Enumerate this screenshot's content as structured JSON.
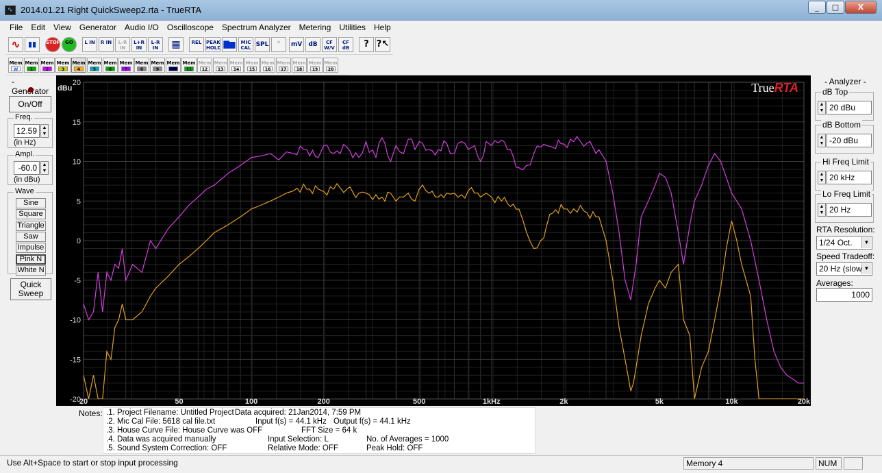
{
  "window": {
    "title": "2014.01.21 Right QuickSweep2.rta - TrueRTA",
    "min": "_",
    "max": "□",
    "close": "X"
  },
  "menu": [
    "File",
    "Edit",
    "View",
    "Generator",
    "Audio I/O",
    "Oscilloscope",
    "Spectrum Analyzer",
    "Metering",
    "Utilities",
    "Help"
  ],
  "toolbar1": [
    {
      "name": "sine-wave-icon",
      "t": "∿",
      "x": 4
    },
    {
      "name": "spectrum-icon",
      "t": "▮▮",
      "x": 28
    },
    {
      "name": "stop-button",
      "t": "STOP",
      "x": 58
    },
    {
      "name": "go-button",
      "t": "GO",
      "x": 82
    },
    {
      "name": "l-in-button",
      "t": "L IN",
      "x": 112
    },
    {
      "name": "r-in-button",
      "t": "R IN",
      "x": 136
    },
    {
      "name": "l-r-in-button",
      "t": "L-R IN",
      "x": 160,
      "dis": true
    },
    {
      "name": "lr-in-button",
      "t": "L+R IN",
      "x": 184
    },
    {
      "name": "lmr-in-button",
      "t": "L-R IN",
      "x": 208
    },
    {
      "name": "grid-button",
      "t": "▦",
      "x": 238
    },
    {
      "name": "rel-button",
      "t": "REL",
      "x": 268
    },
    {
      "name": "peak-hold-button",
      "t": "PEAK HOLD",
      "x": 292
    },
    {
      "name": "bars-button",
      "t": "▇▆",
      "x": 316
    },
    {
      "name": "mic-cal-button",
      "t": "MIC CAL",
      "x": 340
    },
    {
      "name": "spl-button",
      "t": "SPL",
      "x": 364
    },
    {
      "name": "x-button",
      "t": "✕",
      "x": 388,
      "dis": true
    },
    {
      "name": "mv-button",
      "t": "mV",
      "x": 414
    },
    {
      "name": "db-button",
      "t": "dB",
      "x": 438
    },
    {
      "name": "cf-wv-button",
      "t": "CF W/V",
      "x": 462
    },
    {
      "name": "cf-db-button",
      "t": "CF dB",
      "x": 486
    },
    {
      "name": "help-button",
      "t": "?",
      "x": 516
    },
    {
      "name": "context-help-button",
      "t": "?↖",
      "x": 540
    }
  ],
  "memory": [
    "W",
    "1",
    "2",
    "3",
    "4",
    "5",
    "6",
    "7",
    "8",
    "9",
    "10",
    "11",
    "12",
    "13",
    "14",
    "15",
    "16",
    "17",
    "18",
    "19",
    "20"
  ],
  "memory_prefix": "Mem",
  "generator": {
    "legend": "- Generator -",
    "onoff": "On/Off",
    "freq_label": "Freq.",
    "freq_value": "12.59",
    "freq_unit": "(in Hz)",
    "ampl_label": "Ampl.",
    "ampl_value": "-60.0",
    "ampl_unit": "(in dBu)",
    "wave_label": "Wave",
    "waves": [
      "Sine",
      "Square",
      "Triangle",
      "Saw",
      "Impulse",
      "Pink N",
      "White N"
    ],
    "quick1": "Quick",
    "quick2": "Sweep"
  },
  "analyzer": {
    "legend": "- Analyzer -",
    "dbtop_label": "dB Top",
    "dbtop": "20 dBu",
    "dbbot_label": "dB Bottom",
    "dbbot": "-20 dBu",
    "hifreq_label": "Hi Freq Limit",
    "hifreq": "20 kHz",
    "lofreq_label": "Lo Freq Limit",
    "lofreq": "20 Hz",
    "res_label": "RTA Resolution:",
    "res": "1/24 Oct.",
    "speed_label": "Speed Tradeoff:",
    "speed": "20 Hz (slow)",
    "avg_label": "Averages:",
    "avg": "1000"
  },
  "chart_data": {
    "type": "line",
    "brand": "True",
    "brand2": "RTA",
    "ylabel": "dBu",
    "yticks": [
      "20",
      "15",
      "10",
      "5",
      "0",
      "-5",
      "-10",
      "-15",
      "-20"
    ],
    "xticks": [
      {
        "f": 20,
        "l": "20"
      },
      {
        "f": 50,
        "l": "50"
      },
      {
        "f": 100,
        "l": "100"
      },
      {
        "f": 200,
        "l": "200"
      },
      {
        "f": 500,
        "l": "500"
      },
      {
        "f": 1000,
        "l": "1kHz"
      },
      {
        "f": 2000,
        "l": "2k"
      },
      {
        "f": 5000,
        "l": "5k"
      },
      {
        "f": 10000,
        "l": "10k"
      },
      {
        "f": 20000,
        "l": "20k"
      }
    ],
    "xlim": [
      20,
      20000
    ],
    "ylim": [
      -20,
      20
    ],
    "xscale": "log",
    "grid": true,
    "series": [
      {
        "color": "#d53fe0",
        "x": [
          20,
          21,
          22,
          23,
          24,
          25,
          26,
          27,
          28,
          29,
          30,
          32,
          35,
          38,
          40,
          45,
          50,
          55,
          60,
          65,
          70,
          80,
          90,
          100,
          110,
          120,
          130,
          140,
          150,
          170,
          190,
          200,
          220,
          250,
          280,
          300,
          330,
          350,
          380,
          400,
          430,
          450,
          480,
          500,
          550,
          600,
          650,
          700,
          750,
          800,
          850,
          900,
          950,
          1000,
          1100,
          1200,
          1300,
          1400,
          1500,
          1600,
          1700,
          1800,
          2000,
          2200,
          2500,
          2800,
          3000,
          3200,
          3400,
          3600,
          3800,
          4000,
          4200,
          4500,
          4800,
          5000,
          5300,
          5600,
          6000,
          6300,
          6700,
          7000,
          7500,
          8000,
          8500,
          9000,
          9500,
          10000,
          10500,
          11000,
          12000,
          13000,
          14000,
          15000,
          16000,
          17000,
          18000,
          19000,
          20000
        ],
        "y": [
          -8,
          -10,
          -9,
          -4,
          -9,
          -4,
          -5,
          -3,
          -3.5,
          -1,
          -5,
          -3,
          -4,
          0,
          -1,
          1.5,
          3,
          4.5,
          5.5,
          6.5,
          7,
          8.5,
          9.5,
          10.5,
          10.7,
          11,
          10.2,
          11.2,
          11,
          11.5,
          10.5,
          12,
          11,
          11.8,
          10.5,
          12.5,
          10.5,
          13,
          10,
          12,
          11,
          12.8,
          11.5,
          12.5,
          11.5,
          11.5,
          12.3,
          11,
          12.5,
          11.5,
          12,
          10,
          12.5,
          12,
          12.7,
          11.5,
          9.2,
          9.5,
          11,
          11.8,
          12,
          11.8,
          12.2,
          12.5,
          12.3,
          11.5,
          10,
          6,
          1,
          -5,
          -7.5,
          -3,
          3,
          5,
          7,
          8.5,
          8,
          6,
          1,
          -3,
          2,
          5,
          7,
          9.5,
          11,
          10,
          8,
          6,
          5,
          4,
          0,
          -5,
          -10,
          -14,
          -16,
          -17,
          -17.5,
          -18,
          -18
        ]
      },
      {
        "color": "#e2a01f",
        "x": [
          20,
          21,
          22,
          23,
          24,
          25,
          26,
          27,
          28,
          29,
          30,
          32,
          35,
          38,
          40,
          45,
          50,
          55,
          60,
          65,
          70,
          80,
          90,
          100,
          110,
          120,
          130,
          140,
          150,
          170,
          190,
          200,
          220,
          250,
          280,
          300,
          330,
          350,
          380,
          400,
          430,
          450,
          480,
          500,
          550,
          600,
          650,
          700,
          750,
          800,
          850,
          900,
          950,
          1000,
          1100,
          1200,
          1300,
          1400,
          1500,
          1600,
          1700,
          1800,
          2000,
          2200,
          2500,
          2800,
          3000,
          3200,
          3400,
          3600,
          3800,
          3900,
          4000,
          4200,
          4500,
          4800,
          5000,
          5300,
          5600,
          6000,
          6300,
          6700,
          7000,
          7500,
          8000,
          8500,
          9000,
          9500,
          10000,
          10500,
          11000,
          12000,
          12500,
          13000,
          14000,
          15000,
          16000,
          17000,
          18000,
          19000,
          20000
        ],
        "y": [
          -17,
          -20,
          -17,
          -20,
          -20,
          -14,
          -15,
          -11,
          -10,
          -8,
          -10,
          -10,
          -9,
          -7,
          -6,
          -4.5,
          -3,
          -2,
          -1,
          0,
          1,
          2,
          3,
          4,
          4.5,
          5,
          5.5,
          6,
          6.3,
          6.5,
          6.5,
          6.2,
          6.5,
          6.5,
          6,
          6,
          5.8,
          5.5,
          6,
          5,
          5.5,
          6,
          5,
          6.5,
          6,
          5.5,
          6,
          6,
          5.8,
          6.3,
          6,
          5.5,
          6,
          5.5,
          5,
          4.3,
          4,
          1,
          -1,
          0,
          2,
          3.5,
          4,
          4,
          3.5,
          3,
          0,
          -5,
          -11,
          -15,
          -19,
          -18,
          -16,
          -12,
          -8,
          -6,
          -5,
          -6,
          -4,
          -3,
          -10,
          -12,
          -20,
          -16,
          -14,
          -10,
          -6,
          -1,
          2.5,
          0,
          -3,
          -7,
          -15,
          -20,
          -20,
          -20,
          -20,
          -20,
          -20,
          -20,
          -20
        ]
      }
    ]
  },
  "notes": {
    "label": "Notes:",
    "lines": [
      ".1. Project Filename: Untitled Project",
      ".2. Mic Cal File: 5618 cal file.txt",
      ".3. House Curve File: House Curve was OFF",
      ".4. Data was acquired manually",
      ".5. Sound System Correction: OFF"
    ],
    "acq": "Data acquired: 21Jan2014, 7:59 PM",
    "input_fs": "Input f(s) = 44.1 kHz",
    "output_fs": "Output f(s) = 44.1 kHz",
    "fft": "FFT Size = 64 k",
    "input_sel": "Input Selection: L",
    "averages": "No. of Averages = 1000",
    "relmode": "Relative Mode:  OFF",
    "peakhold": "Peak Hold: OFF"
  },
  "status": {
    "hint": "Use Alt+Space to start or stop input processing",
    "memory": "Memory 4",
    "num": "NUM"
  }
}
